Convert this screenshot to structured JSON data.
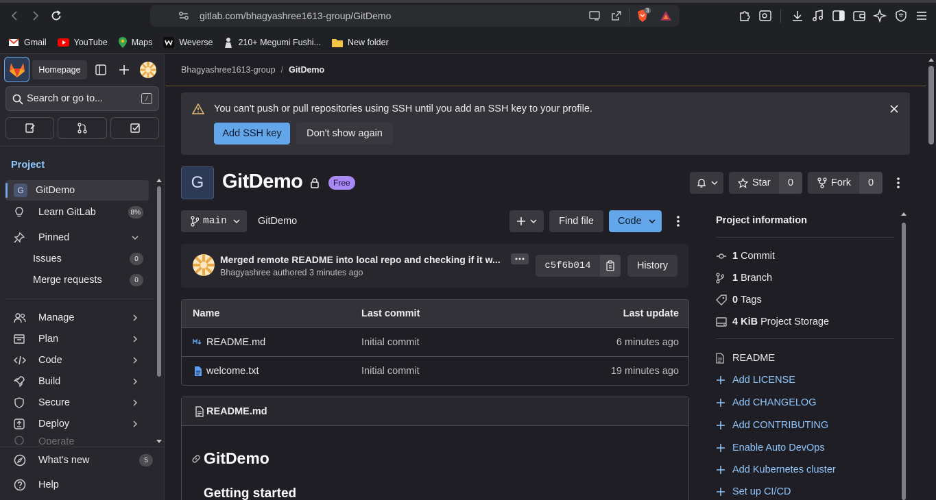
{
  "browser": {
    "url": "gitlab.com/bhagyashree1613-group/GitDemo",
    "shield_count": "3",
    "bookmarks": [
      {
        "label": "Gmail",
        "icon": "gmail-icon",
        "color": "#ea4335"
      },
      {
        "label": "YouTube",
        "icon": "youtube-icon",
        "color": "#ff0000"
      },
      {
        "label": "Maps",
        "icon": "maps-icon",
        "color": "#34a853"
      },
      {
        "label": "Weverse",
        "icon": "weverse-icon",
        "color": "#ffffff"
      },
      {
        "label": "210+ Megumi Fushi...",
        "icon": "megumi-icon",
        "color": "#ffffff"
      },
      {
        "label": "New folder",
        "icon": "folder-icon",
        "color": "#f6c344"
      }
    ]
  },
  "sidebar": {
    "homepage_tooltip": "Homepage",
    "search_placeholder": "Search or go to...",
    "search_shortcut": "/",
    "section_title": "Project",
    "project_initial": "G",
    "items": [
      {
        "label": "GitDemo",
        "icon": "project-avatar",
        "active": true
      },
      {
        "label": "Learn GitLab",
        "icon": "bulb-icon",
        "badge": "8%"
      },
      {
        "label": "Pinned",
        "icon": "pin-icon",
        "expanded": true
      },
      {
        "label": "Issues",
        "badge": "0"
      },
      {
        "label": "Merge requests",
        "badge": "0"
      },
      {
        "label": "Manage",
        "icon": "users-icon"
      },
      {
        "label": "Plan",
        "icon": "plan-icon"
      },
      {
        "label": "Code",
        "icon": "code-icon"
      },
      {
        "label": "Build",
        "icon": "rocket-icon"
      },
      {
        "label": "Secure",
        "icon": "shield-icon"
      },
      {
        "label": "Deploy",
        "icon": "deploy-icon"
      },
      {
        "label": "Operate",
        "icon": "operate-icon"
      }
    ],
    "whats_new": {
      "label": "What's new",
      "badge": "5"
    },
    "help": {
      "label": "Help"
    }
  },
  "breadcrumb": {
    "group": "Bhagyashree1613-group",
    "separator": "/",
    "project": "GitDemo"
  },
  "alert": {
    "message": "You can't push or pull repositories using SSH until you add an SSH key to your profile.",
    "primary": "Add SSH key",
    "secondary": "Don't show again"
  },
  "project": {
    "initial": "G",
    "name": "GitDemo",
    "tier": "Free",
    "star_label": "Star",
    "star_count": "0",
    "fork_label": "Fork",
    "fork_count": "0"
  },
  "repo_bar": {
    "branch": "main",
    "path": "GitDemo",
    "find_file": "Find file",
    "code": "Code"
  },
  "last_commit": {
    "message": "Merged remote README into local repo and checking if it w...",
    "author": "Bhagyashree",
    "meta": "authored 3 minutes ago",
    "sha": "c5f6b014",
    "history": "History"
  },
  "files": {
    "columns": [
      "Name",
      "Last commit",
      "Last update"
    ],
    "rows": [
      {
        "name": "README.md",
        "icon": "markdown-icon",
        "commit": "Initial commit",
        "updated": "6 minutes ago"
      },
      {
        "name": "welcome.txt",
        "icon": "file-icon",
        "commit": "Initial commit",
        "updated": "19 minutes ago"
      }
    ]
  },
  "readme": {
    "filename": "README.md",
    "h1": "GitDemo",
    "h2": "Getting started"
  },
  "project_info": {
    "title": "Project information",
    "stats": [
      {
        "bold": "1",
        "text": "Commit",
        "icon": "commit-icon"
      },
      {
        "bold": "1",
        "text": "Branch",
        "icon": "branch-icon"
      },
      {
        "bold": "0",
        "text": "Tags",
        "icon": "tag-icon"
      },
      {
        "bold": "4 KiB",
        "text": "Project Storage",
        "icon": "storage-icon"
      }
    ],
    "readme": "README",
    "links": [
      "Add LICENSE",
      "Add CHANGELOG",
      "Add CONTRIBUTING",
      "Enable Auto DevOps",
      "Add Kubernetes cluster",
      "Set up CI/CD"
    ]
  }
}
